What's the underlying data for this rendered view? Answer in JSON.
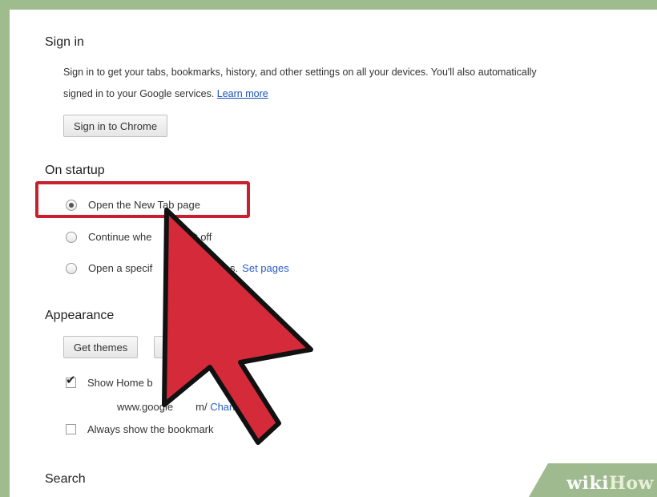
{
  "signin": {
    "title": "Sign in",
    "desc_line1": "Sign in to get your tabs, bookmarks, history, and other settings on all your devices. You'll also automatically",
    "desc_line2": "signed in to your Google services.",
    "learn_more": "Learn more",
    "button": "Sign in to Chrome"
  },
  "startup": {
    "title": "On startup",
    "options": [
      {
        "label": "Open the New Tab page",
        "checked": true
      },
      {
        "label": "Continue whe      ou left off",
        "checked": false
      },
      {
        "label": "Open a specif         set of pages.",
        "checked": false
      }
    ],
    "set_pages": "Set pages"
  },
  "appearance": {
    "title": "Appearance",
    "get_themes": "Get themes",
    "show_home": "Show Home b",
    "home_url": "www.google",
    "home_url_rest": "m/",
    "change": "Chan",
    "bookmarks_bar": "Always show the bookmark"
  },
  "search": {
    "title": "Search"
  },
  "watermark": {
    "part1": "wiki",
    "part2": "How"
  },
  "colors": {
    "highlight": "#c8202f",
    "arrow_fill": "#d42a3a",
    "link": "#2a5cc8",
    "frame": "#9fbc8f"
  }
}
